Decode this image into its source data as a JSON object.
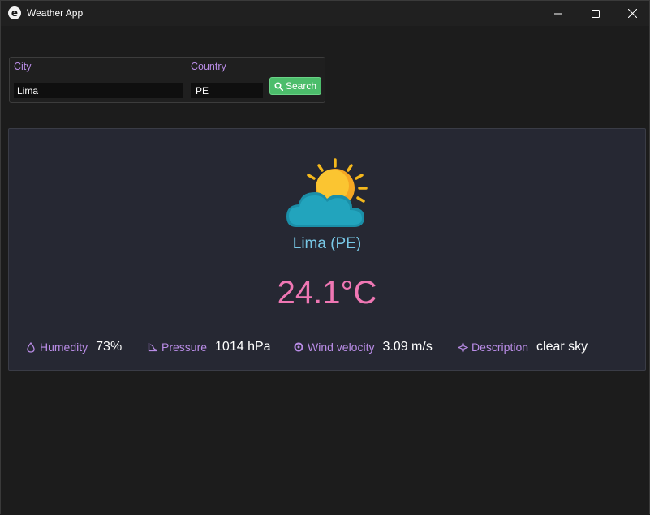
{
  "window": {
    "title": "Weather App"
  },
  "search": {
    "city_label": "City",
    "city_value": "Lima",
    "country_label": "Country",
    "country_value": "PE",
    "button_label": "Search"
  },
  "weather": {
    "icon": "sun-behind-cloud-icon",
    "location": "Lima (PE)",
    "temperature": "24.1°C",
    "humidity": {
      "label": "Humedity",
      "value": "73%"
    },
    "pressure": {
      "label": "Pressure",
      "value": "1014 hPa"
    },
    "wind": {
      "label": "Wind velocity",
      "value": "3.09 m/s"
    },
    "description": {
      "label": "Description",
      "value": "clear sky"
    }
  },
  "colors": {
    "accent_label": "#b98ce6",
    "location": "#78c8e6",
    "temperature": "#ef77b4",
    "search_button": "#4cbd6b"
  }
}
